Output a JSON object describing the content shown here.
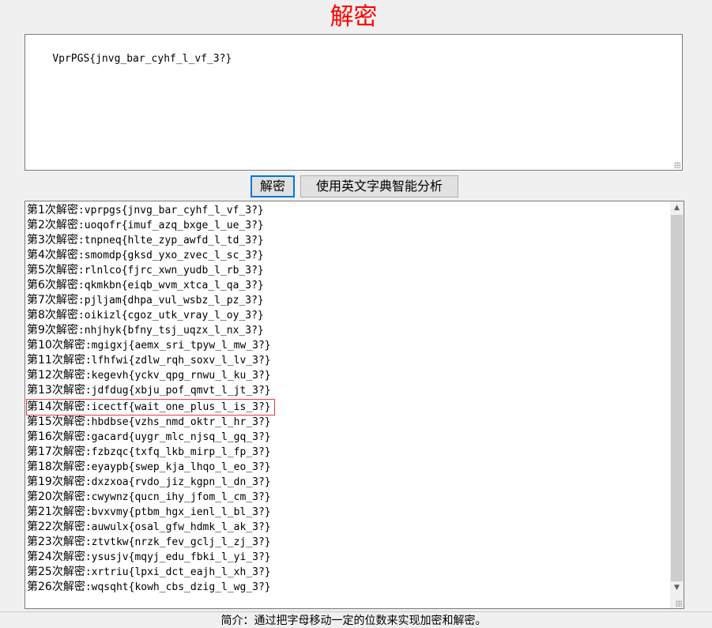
{
  "header": {
    "title": "解密"
  },
  "input": {
    "value": "VprPGS{jnvg_bar_cyhf_l_vf_3?}"
  },
  "buttons": {
    "decrypt_label": "解密",
    "analyze_label": "使用英文字典智能分析"
  },
  "output": {
    "lines": [
      {
        "prefix": "第1次解密",
        "code": ":vprpgs{jnvg_bar_cyhf_l_vf_3?}"
      },
      {
        "prefix": "第2次解密",
        "code": ":uoqofr{imuf_azq_bxge_l_ue_3?}"
      },
      {
        "prefix": "第3次解密",
        "code": ":tnpneq{hlte_zyp_awfd_l_td_3?}"
      },
      {
        "prefix": "第4次解密",
        "code": ":smomdp{gksd_yxo_zvec_l_sc_3?}"
      },
      {
        "prefix": "第5次解密",
        "code": ":rlnlco{fjrc_xwn_yudb_l_rb_3?}"
      },
      {
        "prefix": "第6次解密",
        "code": ":qkmkbn{eiqb_wvm_xtca_l_qa_3?}"
      },
      {
        "prefix": "第7次解密",
        "code": ":pjljam{dhpa_vul_wsbz_l_pz_3?}"
      },
      {
        "prefix": "第8次解密",
        "code": ":oikizl{cgoz_utk_vray_l_oy_3?}"
      },
      {
        "prefix": "第9次解密",
        "code": ":nhjhyk{bfny_tsj_uqzx_l_nx_3?}"
      },
      {
        "prefix": "第10次解密",
        "code": ":mgigxj{aemx_sri_tpyw_l_mw_3?}"
      },
      {
        "prefix": "第11次解密",
        "code": ":lfhfwi{zdlw_rqh_soxv_l_lv_3?}"
      },
      {
        "prefix": "第12次解密",
        "code": ":kegevh{yckv_qpg_rnwu_l_ku_3?}"
      },
      {
        "prefix": "第13次解密",
        "code": ":jdfdug{xbju_pof_qmvt_l_jt_3?}"
      },
      {
        "prefix": "第14次解密",
        "code": ":icectf{wait_one_plus_l_is_3?}"
      },
      {
        "prefix": "第15次解密",
        "code": ":hbdbse{vzhs_nmd_oktr_l_hr_3?}"
      },
      {
        "prefix": "第16次解密",
        "code": ":gacard{uygr_mlc_njsq_l_gq_3?}"
      },
      {
        "prefix": "第17次解密",
        "code": ":fzbzqc{txfq_lkb_mirp_l_fp_3?}"
      },
      {
        "prefix": "第18次解密",
        "code": ":eyaypb{swep_kja_lhqo_l_eo_3?}"
      },
      {
        "prefix": "第19次解密",
        "code": ":dxzxoa{rvdo_jiz_kgpn_l_dn_3?}"
      },
      {
        "prefix": "第20次解密",
        "code": ":cwywnz{qucn_ihy_jfom_l_cm_3?}"
      },
      {
        "prefix": "第21次解密",
        "code": ":bvxvmy{ptbm_hgx_ienl_l_bl_3?}"
      },
      {
        "prefix": "第22次解密",
        "code": ":auwulx{osal_gfw_hdmk_l_ak_3?}"
      },
      {
        "prefix": "第23次解密",
        "code": ":ztvtkw{nrzk_fev_gclj_l_zj_3?}"
      },
      {
        "prefix": "第24次解密",
        "code": ":ysusjv{mqyj_edu_fbki_l_yi_3?}"
      },
      {
        "prefix": "第25次解密",
        "code": ":xrtriu{lpxi_dct_eajh_l_xh_3?}"
      },
      {
        "prefix": "第26次解密",
        "code": ":wqsqht{kowh_cbs_dzig_l_wg_3?}"
      }
    ],
    "highlighted_index": 13
  },
  "footer": {
    "text": "简介：通过把字母移动一定的位数来实现加密和解密。"
  },
  "colors": {
    "title": "#ff0000",
    "highlight_border": "#e04040",
    "focus_border": "#0078d7"
  },
  "icons": {
    "scroll_up": "chevron-up-icon",
    "scroll_down": "chevron-down-icon",
    "resize_grip": "resize-grip-icon"
  }
}
